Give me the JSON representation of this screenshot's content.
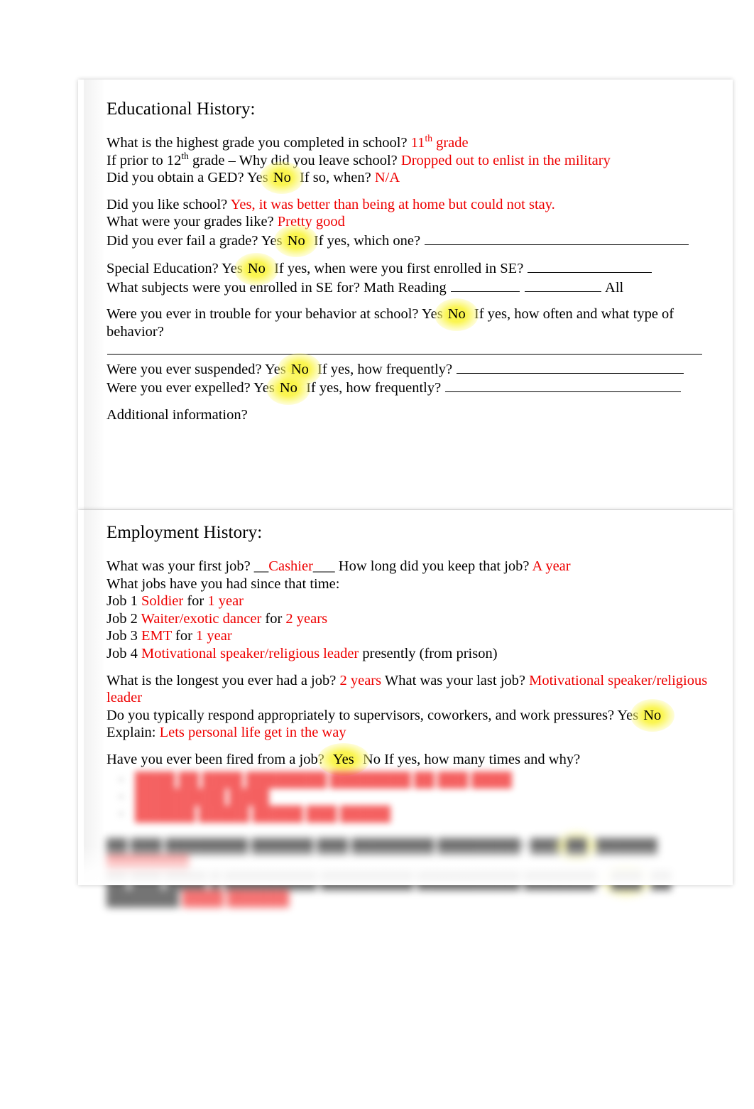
{
  "document": {
    "pages": [
      {
        "id": "educational-history",
        "title": "Educational History:",
        "blocks": [
          {
            "id": "grade",
            "segments": [
              {
                "t": "What is the highest grade you completed in school? ",
                "c": "q"
              },
              {
                "t": "11",
                "c": "a"
              },
              {
                "t": "th",
                "c": "a-sup"
              },
              {
                "t": " grade",
                "c": "a"
              }
            ]
          },
          {
            "id": "leave-school",
            "segments": [
              {
                "t": "If prior to 12",
                "c": "q"
              },
              {
                "t": "th",
                "c": "q-sup"
              },
              {
                "t": " grade – Why did you leave school? ",
                "c": "q"
              },
              {
                "t": "Dropped out to enlist in the military",
                "c": "a"
              }
            ]
          },
          {
            "id": "ged",
            "segments": [
              {
                "t": "Did you obtain a GED?   Yes",
                "c": "q"
              },
              {
                "t": "No",
                "c": "hl"
              },
              {
                "t": "        If so, when? ",
                "c": "q"
              },
              {
                "t": "N/A",
                "c": "a"
              }
            ]
          },
          {
            "id": "spacer-1",
            "spacer": "sm"
          },
          {
            "id": "like-school",
            "segments": [
              {
                "t": "Did you like school? ",
                "c": "q"
              },
              {
                "t": "Yes, it was better than being at home but could not stay.",
                "c": "a"
              }
            ]
          },
          {
            "id": "grades-like",
            "segments": [
              {
                "t": "What were your grades like? ",
                "c": "q"
              },
              {
                "t": "Pretty good",
                "c": "a"
              }
            ]
          },
          {
            "id": "fail-grade",
            "segments": [
              {
                "t": "Did you ever fail a grade?   Yes",
                "c": "q"
              },
              {
                "t": "No",
                "c": "hl"
              },
              {
                "t": "  If yes, which one? ",
                "c": "q"
              },
              {
                "t": "",
                "c": "rule-which"
              }
            ]
          },
          {
            "id": "spacer-2",
            "spacer": "sm"
          },
          {
            "id": "special-education",
            "segments": [
              {
                "t": "Special Education?      Yes",
                "c": "q"
              },
              {
                "t": "No",
                "c": "hl"
              },
              {
                "t": "       If yes, when were you first enrolled in SE? ",
                "c": "q"
              },
              {
                "t": "",
                "c": "rule-w1"
              }
            ]
          },
          {
            "id": "se-subjects",
            "segments": [
              {
                "t": "What subjects were you enrolled in SE for?      Math      Reading    ",
                "c": "q"
              },
              {
                "t": "",
                "c": "rule-w2"
              },
              {
                "t": "  ",
                "c": "q"
              },
              {
                "t": "",
                "c": "rule-w3"
              },
              {
                "t": "   All",
                "c": "q"
              }
            ]
          },
          {
            "id": "spacer-3",
            "spacer": "sm"
          },
          {
            "id": "behavior-trouble",
            "segments": [
              {
                "t": "Were you ever in trouble for your behavior at school?   Yes",
                "c": "q"
              },
              {
                "t": "No",
                "c": "hl"
              },
              {
                "t": "  If yes, how often and what type of behavior? ",
                "c": "q"
              },
              {
                "t": "",
                "c": "rule-full"
              }
            ]
          },
          {
            "id": "suspended",
            "segments": [
              {
                "t": "Were you ever suspended?  Yes",
                "c": "q"
              },
              {
                "t": "No",
                "c": "hl"
              },
              {
                "t": "   If yes, how frequently? ",
                "c": "q"
              },
              {
                "t": "",
                "c": "rule-freq"
              }
            ]
          },
          {
            "id": "expelled",
            "segments": [
              {
                "t": "Were you ever expelled?  Yes",
                "c": "q"
              },
              {
                "t": "No",
                "c": "hl"
              },
              {
                "t": "   If yes, how frequently? ",
                "c": "q"
              },
              {
                "t": "",
                "c": "rule-freq2"
              }
            ]
          },
          {
            "id": "spacer-4",
            "spacer": "sm"
          },
          {
            "id": "additional-information",
            "segments": [
              {
                "t": "Additional information?",
                "c": "q"
              }
            ]
          }
        ]
      },
      {
        "id": "employment-history",
        "title": "Employment History:",
        "blocks": [
          {
            "id": "first-job",
            "segments": [
              {
                "t": "What was your first job? __",
                "c": "q"
              },
              {
                "t": "Cashier",
                "c": "a"
              },
              {
                "t": "___ How long did you keep that job? ",
                "c": "q"
              },
              {
                "t": "A year",
                "c": "a"
              }
            ]
          },
          {
            "id": "jobs-since",
            "segments": [
              {
                "t": "What jobs have you had since that time:",
                "c": "q"
              }
            ]
          },
          {
            "id": "job-1",
            "segments": [
              {
                "t": "Job 1 ",
                "c": "q"
              },
              {
                "t": "Soldier",
                "c": "a"
              },
              {
                "t": " for ",
                "c": "q"
              },
              {
                "t": "1 year",
                "c": "a"
              }
            ]
          },
          {
            "id": "job-2",
            "segments": [
              {
                "t": "Job 2 ",
                "c": "q"
              },
              {
                "t": "Waiter/exotic dancer",
                "c": "a"
              },
              {
                "t": " for ",
                "c": "q"
              },
              {
                "t": "2 years",
                "c": "a"
              }
            ]
          },
          {
            "id": "job-3",
            "segments": [
              {
                "t": "Job 3 ",
                "c": "q"
              },
              {
                "t": "EMT",
                "c": "a"
              },
              {
                "t": " for ",
                "c": "q"
              },
              {
                "t": "1 year",
                "c": "a"
              }
            ]
          },
          {
            "id": "job-4",
            "segments": [
              {
                "t": "Job 4 ",
                "c": "q"
              },
              {
                "t": "Motivational speaker/religious leader",
                "c": "a"
              },
              {
                "t": " presently (from prison)",
                "c": "q"
              }
            ]
          },
          {
            "id": "spacer-5",
            "spacer": "sm"
          },
          {
            "id": "longest-job",
            "segments": [
              {
                "t": "What is the longest you ever had a job? ",
                "c": "q"
              },
              {
                "t": "2 years",
                "c": "a"
              },
              {
                "t": " What was your last job? ",
                "c": "q"
              },
              {
                "t": "Motivational speaker/religious leader",
                "c": "a"
              }
            ]
          },
          {
            "id": "respond-appropriately",
            "segments": [
              {
                "t": "Do you typically respond appropriately to supervisors, coworkers, and work pressures?   Yes",
                "c": "q"
              },
              {
                "t": "No",
                "c": "hl"
              }
            ]
          },
          {
            "id": "explain",
            "segments": [
              {
                "t": "Explain: ",
                "c": "q"
              },
              {
                "t": "Lets personal life get in the way",
                "c": "a"
              }
            ]
          },
          {
            "id": "spacer-6",
            "spacer": "sm"
          },
          {
            "id": "ever-fired",
            "segments": [
              {
                "t": "Have you ever been fired from a job?  ",
                "c": "q"
              },
              {
                "t": "Yes",
                "c": "hl"
              },
              {
                "t": "   No       If yes, how many times and why?",
                "c": "q"
              }
            ]
          }
        ],
        "redacted": {
          "note": "blurred illegible handwritten answers",
          "list_items": [
            "████ ██  ████ ████████ ████████ ██ ███ ████",
            "█████████ ████",
            "██████ █████  █████ ███ █████"
          ],
          "tail_lines": [
            {
              "segments": [
                {
                  "t": "██ ███ ████████ ██████ ███ ████████ ████████?   ███",
                  "c": "q"
                },
                {
                  "t": "██",
                  "c": "hl"
                },
                {
                  "t": "        ██████ ",
                  "c": "q"
                },
                {
                  "t": "████████",
                  "c": "a"
                }
              ]
            },
            {
              "segments": [
                {
                  "t": "██ ███ ████ █ █████████ █████████ ██████████ ███████?  ",
                  "c": "q"
                },
                {
                  "t": "███",
                  "c": "hl"
                },
                {
                  "t": "    ██      ███████ ",
                  "c": "q"
                },
                {
                  "t": "████ ██████",
                  "c": "a"
                }
              ]
            }
          ]
        }
      }
    ]
  }
}
